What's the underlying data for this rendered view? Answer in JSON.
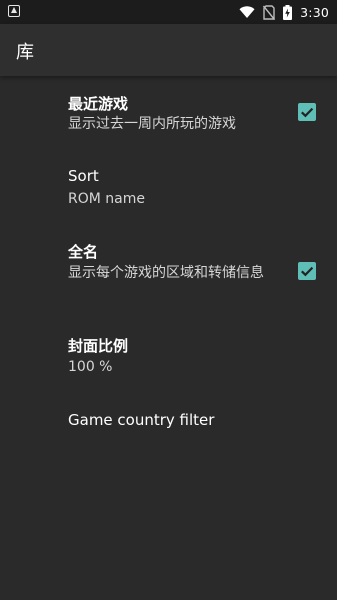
{
  "status_bar": {
    "time": "3:30",
    "icons": [
      "notification-icon",
      "wifi-icon",
      "no-sim-icon",
      "battery-charging-icon"
    ]
  },
  "app_bar": {
    "title": "库"
  },
  "preferences": [
    {
      "title": "最近游戏",
      "summary": "显示过去一周内所玩的游戏",
      "checked": true
    },
    {
      "title": "Sort",
      "summary": "ROM name"
    },
    {
      "title": "全名",
      "summary": "显示每个游戏的区域和转储信息",
      "checked": true
    },
    {
      "title": "封面比例",
      "summary": "100 %"
    },
    {
      "title": "Game country filter"
    }
  ],
  "colors": {
    "background": "#2a2a2a",
    "app_bar": "#2f2f2f",
    "status_bar": "#1c1c1c",
    "accent": "#5fbfb7"
  }
}
